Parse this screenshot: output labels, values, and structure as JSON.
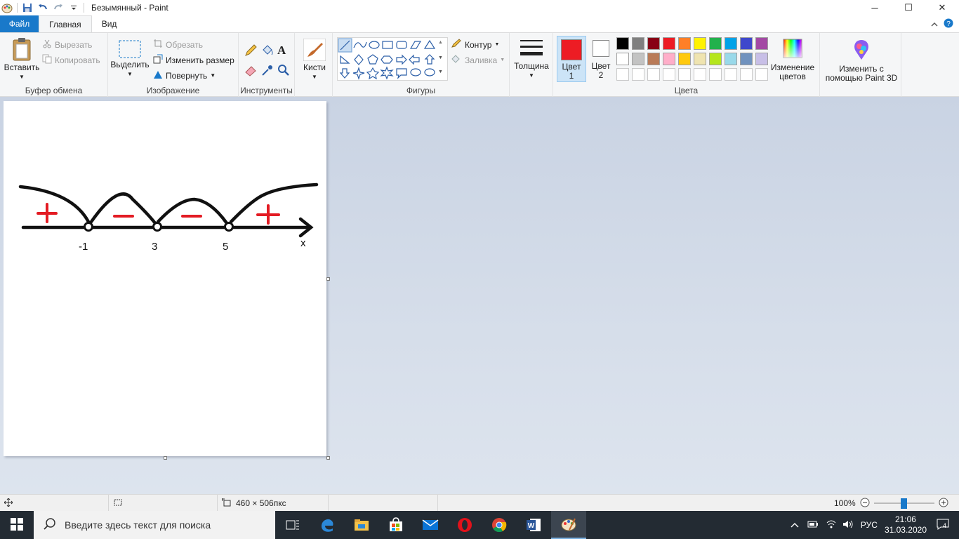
{
  "window": {
    "title": "Безымянный - Paint",
    "controls": {
      "minimize": "─",
      "maximize": "☐",
      "close": "✕"
    }
  },
  "tabs": {
    "file": "Файл",
    "home": "Главная",
    "view": "Вид"
  },
  "ribbon": {
    "clipboard": {
      "label": "Буфер обмена",
      "paste": "Вставить",
      "cut": "Вырезать",
      "copy": "Копировать"
    },
    "image": {
      "label": "Изображение",
      "select": "Выделить",
      "crop": "Обрезать",
      "resize": "Изменить размер",
      "rotate": "Повернуть"
    },
    "tools": {
      "label": "Инструменты"
    },
    "brushes": {
      "label": "Кисти"
    },
    "shapes": {
      "label": "Фигуры",
      "outline": "Контур",
      "fill": "Заливка"
    },
    "size": {
      "label": "Толщина"
    },
    "colors": {
      "label": "Цвета",
      "color1_line1": "Цвет",
      "color1_line2": "1",
      "color2_line1": "Цвет",
      "color2_line2": "2",
      "edit_line1": "Изменение",
      "edit_line2": "цветов",
      "color1": "#ed1c24",
      "color2": "#ffffff",
      "palette_row1": [
        "#000000",
        "#7f7f7f",
        "#880015",
        "#ed1c24",
        "#ff7f27",
        "#fff200",
        "#22b14c",
        "#00a2e8",
        "#3f48cc",
        "#a349a4"
      ],
      "palette_row2": [
        "#ffffff",
        "#c3c3c3",
        "#b97a57",
        "#ffaec9",
        "#ffc90e",
        "#efe4b0",
        "#b5e61d",
        "#99d9ea",
        "#7092be",
        "#c8bfe7"
      ]
    },
    "paint3d": {
      "line1": "Изменить с",
      "line2": "помощью Paint 3D"
    }
  },
  "drawing": {
    "labels": [
      "-1",
      "3",
      "5"
    ],
    "axis_label": "x",
    "signs": [
      "+",
      "−",
      "−",
      "+"
    ],
    "sign_plus_color": "#e31b23",
    "sign_minus_color": "#e31b23"
  },
  "statusbar": {
    "size": "460 × 506пкс",
    "zoom": "100%"
  },
  "taskbar": {
    "search_placeholder": "Введите здесь текст для поиска",
    "lang": "РУС",
    "time": "21:06",
    "date": "31.03.2020",
    "notifications": "4"
  }
}
